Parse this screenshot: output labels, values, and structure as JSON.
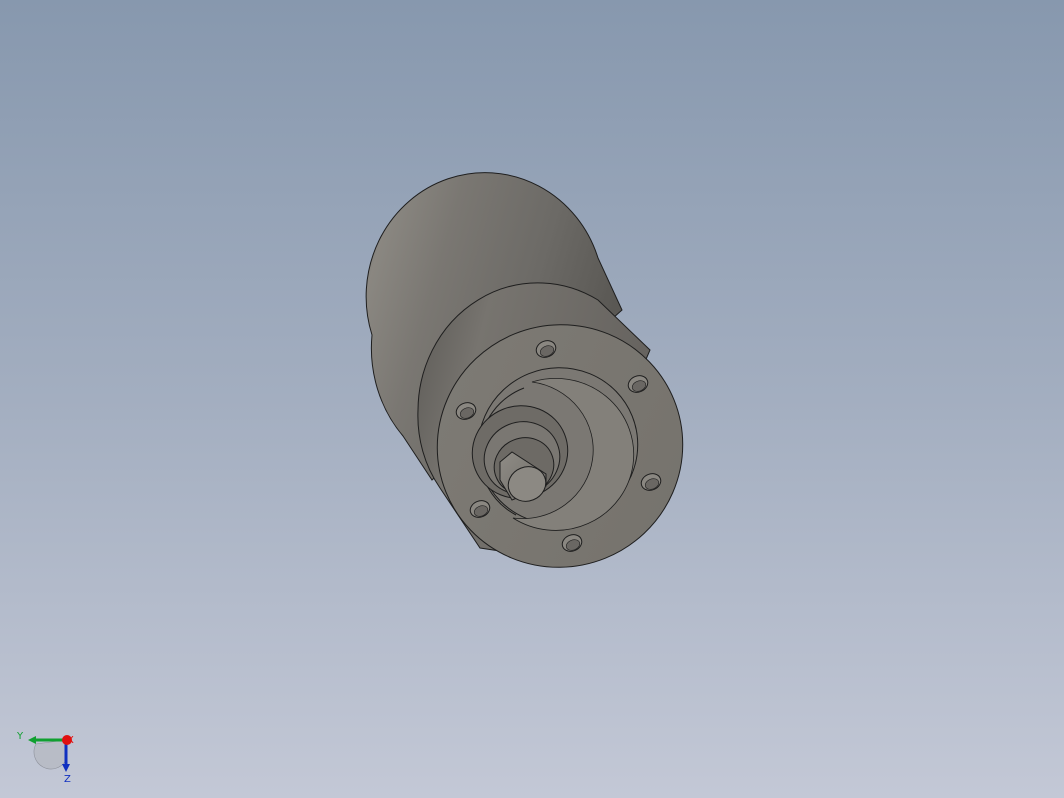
{
  "viewport": {
    "background_top": "#8798ae",
    "background_bottom": "#c3c8d6"
  },
  "model": {
    "part": "gear-motor",
    "body_color": "#787570",
    "face_color": "#7a7771",
    "edge_color": "#1e1e1e",
    "mounting_hole_count": 6
  },
  "triad": {
    "y_label": "Y",
    "x_label": "X",
    "z_label": "Z",
    "x_color": "#e01010",
    "y_color": "#10a030",
    "z_color": "#1030c0"
  }
}
